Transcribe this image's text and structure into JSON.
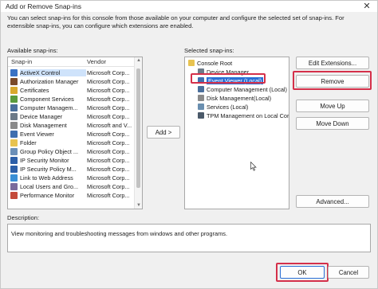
{
  "window": {
    "title": "Add or Remove Snap-ins",
    "close_glyph": "✕"
  },
  "intro_text": "You can select snap-ins for this console from those available on your computer and configure the selected set of snap-ins. For extensible snap-ins, you can configure which extensions are enabled.",
  "available": {
    "label": "Available snap-ins:",
    "col_snapin": "Snap-in",
    "col_vendor": "Vendor",
    "items": [
      {
        "name": "ActiveX Control",
        "vendor": "Microsoft Corp...",
        "icon": "activex-icon",
        "color": "#3a72c4",
        "selected": true
      },
      {
        "name": "Authorization Manager",
        "vendor": "Microsoft Corp...",
        "icon": "authorization-icon",
        "color": "#7b4a2a",
        "selected": false
      },
      {
        "name": "Certificates",
        "vendor": "Microsoft Corp...",
        "icon": "certificate-icon",
        "color": "#d9a92e",
        "selected": false
      },
      {
        "name": "Component Services",
        "vendor": "Microsoft Corp...",
        "icon": "component-icon",
        "color": "#5a9b3d",
        "selected": false
      },
      {
        "name": "Computer Managem...",
        "vendor": "Microsoft Corp...",
        "icon": "computer-icon",
        "color": "#4a6f9c",
        "selected": false
      },
      {
        "name": "Device Manager",
        "vendor": "Microsoft Corp...",
        "icon": "device-icon",
        "color": "#6c7a89",
        "selected": false
      },
      {
        "name": "Disk Management",
        "vendor": "Microsoft and V...",
        "icon": "disk-icon",
        "color": "#8a8a8a",
        "selected": false
      },
      {
        "name": "Event Viewer",
        "vendor": "Microsoft Corp...",
        "icon": "event-viewer-icon",
        "color": "#3f6fb0",
        "selected": false
      },
      {
        "name": "Folder",
        "vendor": "Microsoft Corp...",
        "icon": "folder-icon",
        "color": "#e8c350",
        "selected": false
      },
      {
        "name": "Group Policy Object ...",
        "vendor": "Microsoft Corp...",
        "icon": "policy-icon",
        "color": "#6b8fb8",
        "selected": false
      },
      {
        "name": "IP Security Monitor",
        "vendor": "Microsoft Corp...",
        "icon": "security-icon",
        "color": "#2d5fa8",
        "selected": false
      },
      {
        "name": "IP Security Policy M...",
        "vendor": "Microsoft Corp...",
        "icon": "security-icon",
        "color": "#2d5fa8",
        "selected": false
      },
      {
        "name": "Link to Web Address",
        "vendor": "Microsoft Corp...",
        "icon": "web-link-icon",
        "color": "#3a8fd6",
        "selected": false
      },
      {
        "name": "Local Users and Gro...",
        "vendor": "Microsoft Corp...",
        "icon": "users-icon",
        "color": "#7a6a9c",
        "selected": false
      },
      {
        "name": "Performance Monitor",
        "vendor": "Microsoft Corp...",
        "icon": "performance-icon",
        "color": "#c44a3a",
        "selected": false
      }
    ]
  },
  "add_button": "Add >",
  "selected": {
    "label": "Selected snap-ins:",
    "nodes": [
      {
        "name": "Console Root",
        "icon": "folder-icon",
        "color": "#e8c350",
        "depth": 0,
        "selected": false
      },
      {
        "name": "Device Manager",
        "icon": "device-icon",
        "color": "#6c7a89",
        "depth": 1,
        "selected": false
      },
      {
        "name": "Event Viewer (Local)",
        "icon": "event-viewer-icon",
        "color": "#3f6fb0",
        "depth": 1,
        "selected": true
      },
      {
        "name": "Computer Management (Local)",
        "icon": "computer-icon",
        "color": "#4a6f9c",
        "depth": 1,
        "selected": false
      },
      {
        "name": "Disk Management(Local)",
        "icon": "disk-icon",
        "color": "#8a8a8a",
        "depth": 1,
        "selected": false
      },
      {
        "name": "Services (Local)",
        "icon": "services-icon",
        "color": "#6a8fb0",
        "depth": 1,
        "selected": false
      },
      {
        "name": "TPM Management on Local Cor",
        "icon": "tpm-icon",
        "color": "#4b5a6a",
        "depth": 1,
        "selected": false
      }
    ]
  },
  "buttons": {
    "edit_extensions": "Edit Extensions...",
    "remove": "Remove",
    "move_up": "Move Up",
    "move_down": "Move Down",
    "advanced": "Advanced...",
    "ok": "OK",
    "cancel": "Cancel"
  },
  "description": {
    "label": "Description:",
    "text": "View monitoring and troubleshooting messages from windows and other programs."
  },
  "colors": {
    "highlight_box": "#d4304a",
    "selection": "#2a6fd6"
  }
}
